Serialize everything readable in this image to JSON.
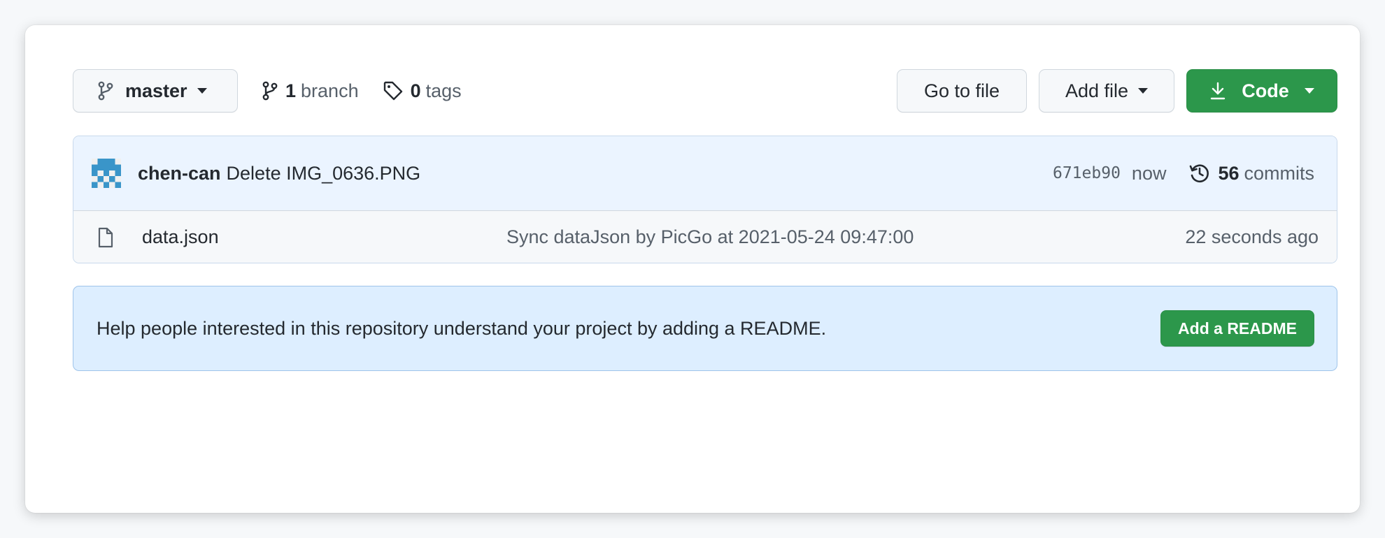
{
  "toolbar": {
    "branch_selector": {
      "label": "master",
      "icon": "git-branch-icon"
    },
    "branches": {
      "count": "1",
      "label": "branch",
      "icon": "git-branch-icon"
    },
    "tags": {
      "count": "0",
      "label": "tags",
      "icon": "tag-icon"
    },
    "go_to_file_label": "Go to file",
    "add_file_label": "Add file",
    "code_label": "Code",
    "code_icon": "download-icon"
  },
  "latest_commit": {
    "author": "chen-can",
    "message": "Delete IMG_0636.PNG",
    "sha": "671eb90",
    "time": "now",
    "commits_count": "56",
    "commits_label": "commits",
    "history_icon": "history-icon",
    "avatar_icon": "identicon-avatar"
  },
  "files": [
    {
      "name": "data.json",
      "icon": "file-icon",
      "last_commit_message": "Sync dataJson by PicGo at 2021-05-24 09:47:00",
      "age": "22 seconds ago"
    }
  ],
  "readme_banner": {
    "text": "Help people interested in this repository understand your project by adding a README.",
    "button_label": "Add a README"
  },
  "colors": {
    "primary_green": "#2c974b",
    "commit_row_bg": "#ebf4ff",
    "banner_bg": "#ddeeff",
    "avatar_blue": "#3a95c9"
  }
}
